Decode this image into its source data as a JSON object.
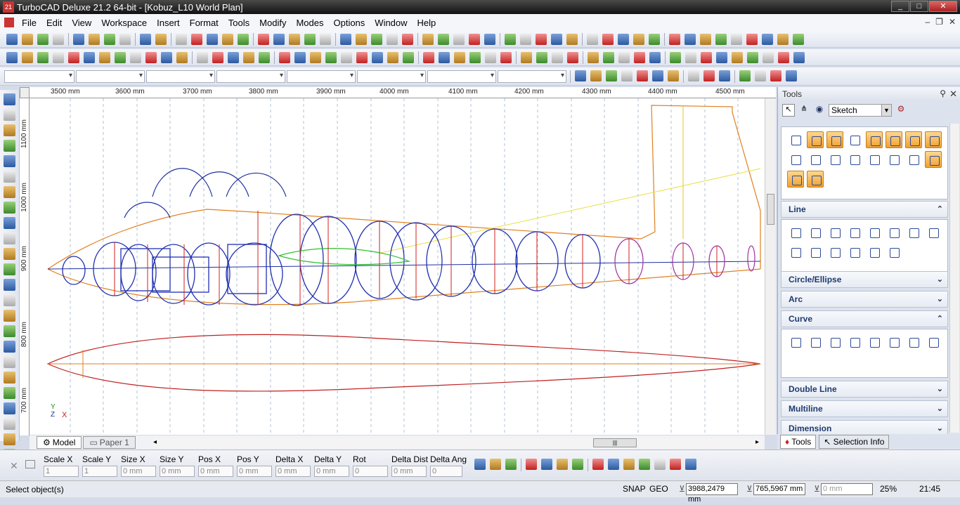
{
  "window": {
    "title": "TurboCAD Deluxe 21.2 64-bit - [Kobuz_L10 World Plan]",
    "app_icon": "21"
  },
  "menu": [
    "File",
    "Edit",
    "View",
    "Workspace",
    "Insert",
    "Format",
    "Tools",
    "Modify",
    "Modes",
    "Options",
    "Window",
    "Help"
  ],
  "ruler": {
    "h_labels": [
      "3500 mm",
      "3600 mm",
      "3700 mm",
      "3800 mm",
      "3900 mm",
      "4000 mm",
      "4100 mm",
      "4200 mm",
      "4300 mm",
      "4400 mm",
      "4500 mm"
    ],
    "v_labels": [
      "1100 mm",
      "1000 mm",
      "900 mm",
      "800 mm",
      "700 mm"
    ]
  },
  "axis": {
    "y": "Y",
    "x": "X",
    "z": "Z"
  },
  "sheet_tabs": {
    "model": "Model",
    "paper": "Paper 1"
  },
  "inspector": {
    "fields": [
      {
        "label": "Scale X",
        "value": "1"
      },
      {
        "label": "Scale Y",
        "value": "1"
      },
      {
        "label": "Size X",
        "value": "0 mm"
      },
      {
        "label": "Size Y",
        "value": "0 mm"
      },
      {
        "label": "Pos X",
        "value": "0 mm"
      },
      {
        "label": "Pos Y",
        "value": "0 mm"
      },
      {
        "label": "Delta X",
        "value": "0 mm"
      },
      {
        "label": "Delta Y",
        "value": "0 mm"
      },
      {
        "label": "Rot",
        "value": "0"
      },
      {
        "label": "Delta Dist",
        "value": "0 mm"
      },
      {
        "label": "Delta Ang",
        "value": "0"
      }
    ]
  },
  "status": {
    "message": "Select object(s)",
    "snap": "SNAP",
    "geo": "GEO",
    "x": "3988,2479 mm",
    "y": "765,5967 mm",
    "z": "0 mm",
    "zoom": "25%",
    "time": "21:45"
  },
  "tools_palette": {
    "title": "Tools",
    "mode": "Sketch",
    "sections": [
      {
        "label": "Line",
        "state": "expanded"
      },
      {
        "label": "Circle/Ellipse",
        "state": "collapsed"
      },
      {
        "label": "Arc",
        "state": "collapsed"
      },
      {
        "label": "Curve",
        "state": "expanded"
      },
      {
        "label": "Double Line",
        "state": "collapsed"
      },
      {
        "label": "Multiline",
        "state": "collapsed"
      },
      {
        "label": "Dimension",
        "state": "collapsed"
      }
    ],
    "bottom_tabs": {
      "tools": "Tools",
      "selection": "Selection Info"
    }
  }
}
